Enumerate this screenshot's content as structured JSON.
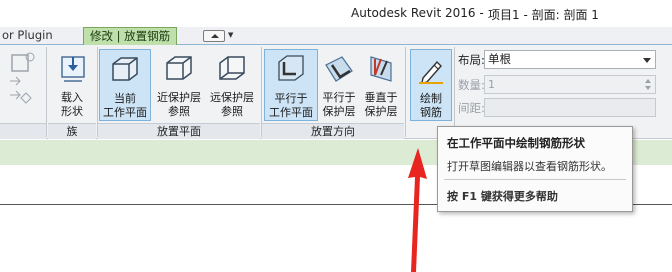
{
  "window": {
    "app_title": "Autodesk Revit 2016 -",
    "doc_title": "项目1 - 剖面: 剖面 1"
  },
  "tabs": {
    "prev_tab_partial": "or Plugin",
    "active_tab": "修改 | 放置钢筋"
  },
  "ribbon": {
    "panels": {
      "left_partial": "",
      "family": "族",
      "placement_plane": "放置平面",
      "placement_direction": "放置方向"
    },
    "buttons": {
      "load_shape": "载入\n形状",
      "current_work_plane": "当前\n工作平面",
      "near_cover": "近保护层\n参照",
      "far_cover": "远保护层\n参照",
      "parallel_work_plane": "平行于\n工作平面",
      "parallel_cover": "平行于\n保护层",
      "perpendicular_cover": "垂直于\n保护层",
      "sketch_rebar": "绘制\n钢筋"
    }
  },
  "options": {
    "layout_label": "布局:",
    "layout_value": "单根",
    "quantity_label": "数量:",
    "quantity_value": "1",
    "spacing_label": "间距:"
  },
  "tooltip": {
    "title": "在工作平面中绘制钢筋形状",
    "description": "打开草图编辑器以查看钢筋形状。",
    "help": "按 F1 键获得更多帮助"
  },
  "colors": {
    "active_tab": "#bfe0ab",
    "pressed_button": "#cde4f6",
    "ribbon_bg": "#f1f2f4",
    "status_strip": "#dcebd3",
    "annotation_arrow": "#e8261f"
  }
}
